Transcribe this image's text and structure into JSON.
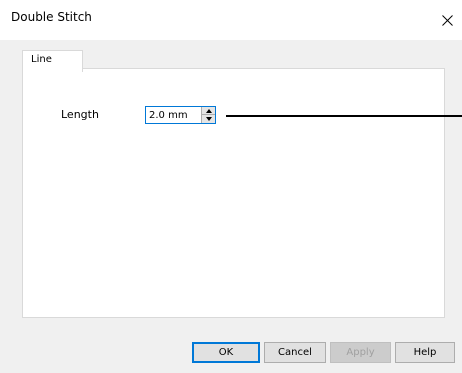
{
  "window": {
    "title": "Double Stitch",
    "close_icon": "close-icon"
  },
  "tabs": [
    {
      "label": "Line",
      "selected": true
    }
  ],
  "line_tab": {
    "length_label": "Length",
    "length_value": "2.0 mm"
  },
  "buttons": {
    "ok": "OK",
    "cancel": "Cancel",
    "apply": "Apply",
    "help": "Help"
  },
  "colors": {
    "focus_accent": "#0078d7",
    "dialog_background": "#f0f0f0",
    "panel_background": "#ffffff"
  }
}
